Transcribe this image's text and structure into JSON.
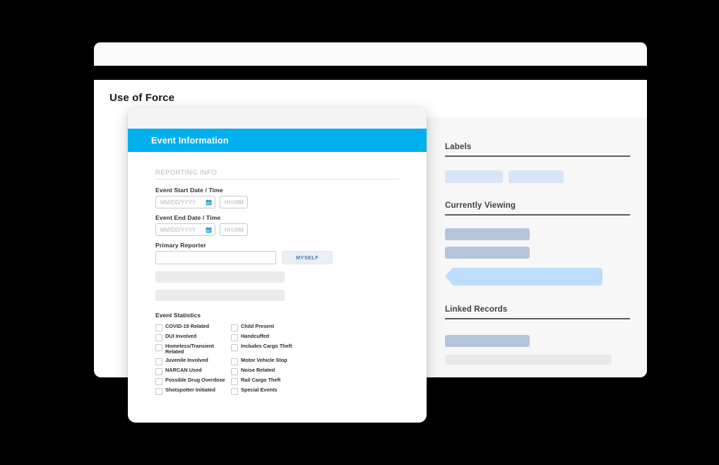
{
  "window": {
    "page_title": "Use of Force"
  },
  "side_panel": {
    "sections": [
      {
        "heading": "Labels"
      },
      {
        "heading": "Currently Viewing"
      },
      {
        "heading": "Linked Records"
      }
    ]
  },
  "modal": {
    "header_title": "Event Information",
    "section_label": "REPORTING INFO",
    "fields": {
      "start_label": "Event Start Date / Time",
      "start_date_placeholder": "MM/DD/YYYY",
      "start_time_placeholder": "HH:MM",
      "end_label": "Event End Date / Time",
      "end_date_placeholder": "MM/DD/YYYY",
      "end_time_placeholder": "HH:MM",
      "reporter_label": "Primary Reporter",
      "reporter_value": "",
      "myself_button": "MYSELF"
    },
    "stats_label": "Event Statistics",
    "checkboxes": [
      {
        "label": "COVID-19 Related",
        "checked": false
      },
      {
        "label": "Child Present",
        "checked": false
      },
      {
        "label": "DUI Involved",
        "checked": false
      },
      {
        "label": "Handcuffed",
        "checked": false
      },
      {
        "label": "Homeless/Transient Related",
        "checked": false
      },
      {
        "label": "Includes Cargo Theft",
        "checked": false
      },
      {
        "label": "Juvenile Involved",
        "checked": false
      },
      {
        "label": "Motor Vehicle Stop",
        "checked": false
      },
      {
        "label": "NARCAN Used",
        "checked": false
      },
      {
        "label": "Noise Related",
        "checked": false
      },
      {
        "label": "Possible Drug Overdose",
        "checked": false
      },
      {
        "label": "Rail Cargo Theft",
        "checked": false
      },
      {
        "label": "Shotspotter Initiated",
        "checked": false
      },
      {
        "label": "Special Events",
        "checked": false
      }
    ]
  },
  "colors": {
    "accent_cyan": "#00b0ed",
    "page_background": "#000000",
    "panel_background": "#f7f7f7",
    "chip_blue": "#d7e6f7",
    "bar_blue_gray": "#b4c5d9",
    "arrow_blue": "#bcddfb",
    "skeleton_gray": "#e9e9e9",
    "myself_text": "#4d78b4"
  }
}
